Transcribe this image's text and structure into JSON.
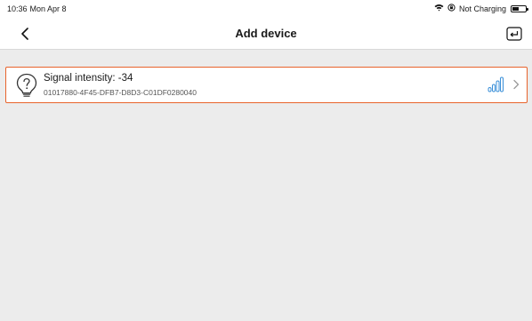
{
  "status_bar": {
    "time": "10:36",
    "date": "Mon Apr 8",
    "charging": "Not Charging",
    "icons": [
      "wifi-icon",
      "orientation-lock-icon",
      "battery-icon"
    ]
  },
  "nav": {
    "title": "Add device",
    "back_icon": "chevron-left-icon",
    "action_icon": "return-icon"
  },
  "devices": [
    {
      "signal_label": "Signal intensity: -34",
      "id": "01017880-4F45-DFB7-D8D3-C01DF0280040",
      "icon": "bulb-icon",
      "signal_level_fraction": 1.0,
      "trailing_icon": "chevron-right-icon"
    }
  ],
  "colors": {
    "accent": "#e8632c",
    "signal": "#3a8fd8",
    "background": "#ececec",
    "surface": "#ffffff"
  }
}
